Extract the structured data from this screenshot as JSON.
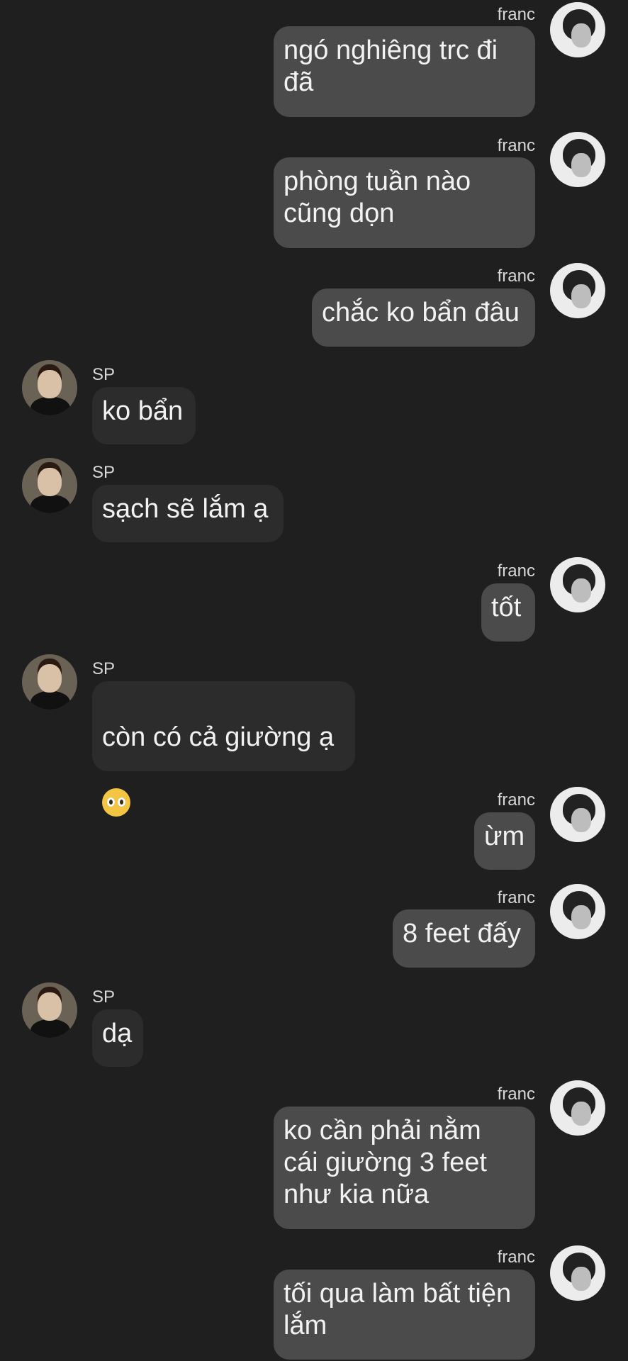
{
  "messages": [
    {
      "sender": "franc",
      "direction": "out",
      "text": "ngó nghiêng trc đi\nđã"
    },
    {
      "sender": "franc",
      "direction": "out",
      "text": "phòng tuần nào\ncũng dọn"
    },
    {
      "sender": "franc",
      "direction": "out",
      "text": "chắc ko bẩn đâu"
    },
    {
      "sender": "SP",
      "direction": "in",
      "text": "ko bẩn"
    },
    {
      "sender": "SP",
      "direction": "in",
      "text": "sạch sẽ lắm ạ"
    },
    {
      "sender": "franc",
      "direction": "out",
      "text": "tốt"
    },
    {
      "sender": "SP",
      "direction": "in",
      "text": "còn có cả giường ạ",
      "emoji": "pleading-face-emoji"
    },
    {
      "sender": "franc",
      "direction": "out",
      "text": "ừm"
    },
    {
      "sender": "franc",
      "direction": "out",
      "text": "8 feet đấy"
    },
    {
      "sender": "SP",
      "direction": "in",
      "text": "dạ"
    },
    {
      "sender": "franc",
      "direction": "out",
      "text": "ko cần phải nằm\ncái giường 3 feet\nnhư kia nữa"
    },
    {
      "sender": "franc",
      "direction": "out",
      "text": "tối qua làm bất tiện\nlắm"
    }
  ],
  "icons": {
    "out_avatar": "avatar-franc",
    "in_avatar": "avatar-sp"
  },
  "colors": {
    "background": "#1f1f1f",
    "outgoing_bubble": "#4b4b4b",
    "incoming_bubble": "#2c2c2c",
    "text": "#f2f2f2",
    "name": "#d8d8d8"
  }
}
